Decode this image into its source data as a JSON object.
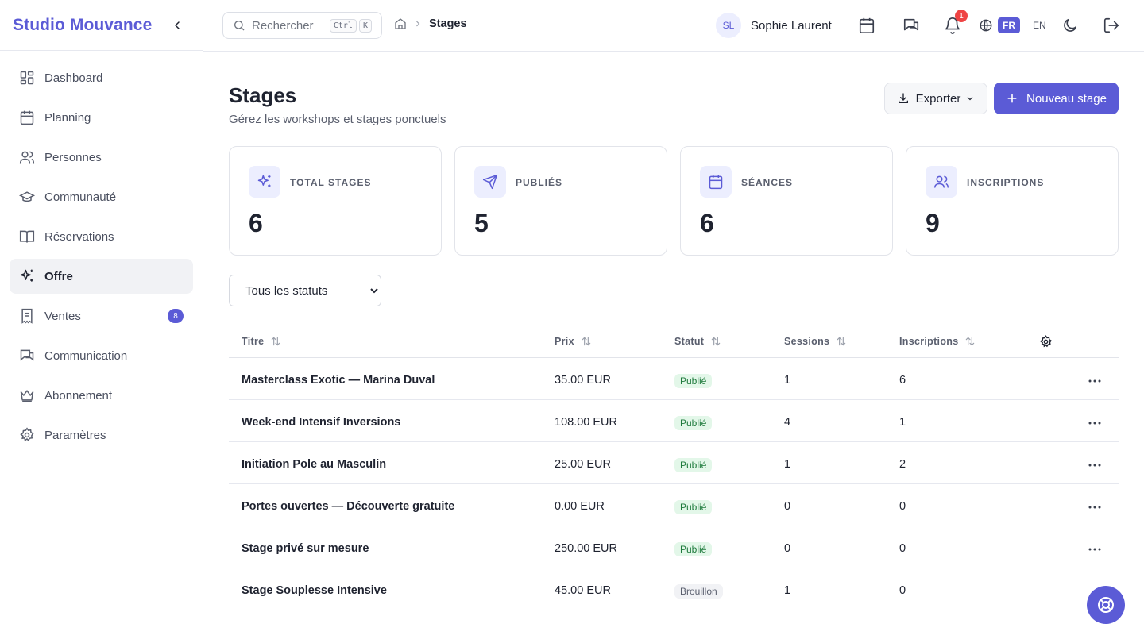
{
  "sidebar": {
    "brand": "Studio Mouvance",
    "items": [
      {
        "label": "Dashboard",
        "icon": "dashboard-icon"
      },
      {
        "label": "Planning",
        "icon": "calendar-icon"
      },
      {
        "label": "Personnes",
        "icon": "users-icon"
      },
      {
        "label": "Communauté",
        "icon": "graduation-cap-icon"
      },
      {
        "label": "Réservations",
        "icon": "book-icon"
      },
      {
        "label": "Offre",
        "icon": "sparkles-icon",
        "active": true
      },
      {
        "label": "Ventes",
        "icon": "receipt-icon",
        "badge": "8"
      },
      {
        "label": "Communication",
        "icon": "chat-icon"
      },
      {
        "label": "Abonnement",
        "icon": "crown-icon"
      },
      {
        "label": "Paramètres",
        "icon": "gear-icon"
      }
    ]
  },
  "topbar": {
    "search_placeholder": "Rechercher",
    "kbd_ctrl": "Ctrl",
    "kbd_k": "K",
    "breadcrumb_current": "Stages",
    "avatar_initials": "SL",
    "user_name": "Sophie Laurent",
    "notification_count": "1",
    "lang_active": "FR",
    "lang_other": "EN"
  },
  "header": {
    "title": "Stages",
    "subtitle": "Gérez les workshops et stages ponctuels",
    "export_label": "Exporter",
    "new_label": "Nouveau stage"
  },
  "stats": [
    {
      "label": "Total stages",
      "value": "6",
      "icon": "sparkles-icon"
    },
    {
      "label": "Publiés",
      "value": "5",
      "icon": "send-icon"
    },
    {
      "label": "Séances",
      "value": "6",
      "icon": "calendar-icon"
    },
    {
      "label": "Inscriptions",
      "value": "9",
      "icon": "users-icon"
    }
  ],
  "filter": {
    "selected": "Tous les statuts"
  },
  "table": {
    "headers": {
      "title": "Titre",
      "price": "Prix",
      "status": "Statut",
      "sessions": "Sessions",
      "inscriptions": "Inscriptions"
    },
    "rows": [
      {
        "title": "Masterclass Exotic — Marina Duval",
        "price": "35.00 EUR",
        "status": "Publié",
        "status_kind": "pub",
        "sessions": "1",
        "inscriptions": "6"
      },
      {
        "title": "Week-end Intensif Inversions",
        "price": "108.00 EUR",
        "status": "Publié",
        "status_kind": "pub",
        "sessions": "4",
        "inscriptions": "1"
      },
      {
        "title": "Initiation Pole au Masculin",
        "price": "25.00 EUR",
        "status": "Publié",
        "status_kind": "pub",
        "sessions": "1",
        "inscriptions": "2"
      },
      {
        "title": "Portes ouvertes — Découverte gratuite",
        "price": "0.00 EUR",
        "status": "Publié",
        "status_kind": "pub",
        "sessions": "0",
        "inscriptions": "0"
      },
      {
        "title": "Stage privé sur mesure",
        "price": "250.00 EUR",
        "status": "Publié",
        "status_kind": "pub",
        "sessions": "0",
        "inscriptions": "0"
      },
      {
        "title": "Stage Souplesse Intensive",
        "price": "45.00 EUR",
        "status": "Brouillon",
        "status_kind": "draft",
        "sessions": "1",
        "inscriptions": "0"
      }
    ]
  },
  "colors": {
    "accent": "#5b5bd6",
    "published_bg": "#e3f7e9",
    "published_text": "#1e7a3c",
    "draft_bg": "#f1f2f5",
    "notification": "#ef4444"
  }
}
